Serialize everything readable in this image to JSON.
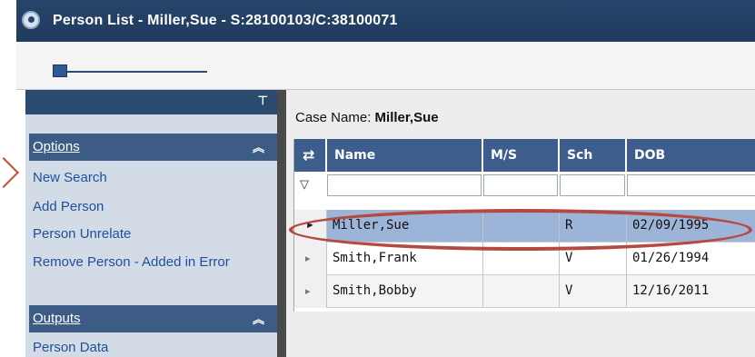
{
  "window": {
    "title": "Person List - Miller,Sue - S:28100103/C:38100071"
  },
  "toolbar": {
    "slider": "slider"
  },
  "sidebar": {
    "sections": [
      {
        "label": "Options",
        "items": [
          "New Search",
          "Add Person",
          "Person Unrelate",
          "Remove Person - Added in Error"
        ]
      },
      {
        "label": "Outputs",
        "items": [
          "Person Data"
        ]
      }
    ]
  },
  "main": {
    "case_label": "Case Name:",
    "case_name": "Miller,Sue",
    "grid": {
      "columns": [
        "Name",
        "M/S",
        "Sch",
        "DOB"
      ],
      "rows": [
        {
          "name": "Miller,Sue",
          "ms": "",
          "sch": "R",
          "dob": "02/09/1995",
          "selected": true
        },
        {
          "name": "Smith,Frank",
          "ms": "",
          "sch": "V",
          "dob": "01/26/1994",
          "selected": false
        },
        {
          "name": "Smith,Bobby",
          "ms": "",
          "sch": "V",
          "dob": "12/16/2011",
          "selected": false
        }
      ]
    }
  },
  "colors": {
    "title_bg": "#27456b",
    "header_bg": "#3d5e8c",
    "selected_row": "#9cb4d8",
    "annotation": "#b5483f"
  },
  "icons": {
    "app": "app-globe-icon",
    "pin": "pin-icon",
    "collapse": "chevron-double-up-icon",
    "filter": "filter-icon",
    "column_chooser": "column-chooser-icon",
    "row_pointer": "row-pointer-icon"
  }
}
